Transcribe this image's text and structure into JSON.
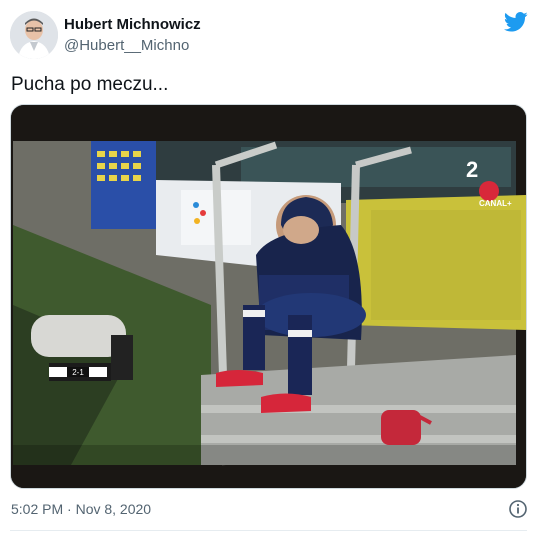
{
  "tweet": {
    "author_name": "Hubert Michnowicz",
    "author_handle": "@Hubert__Michno",
    "text": "Pucha po meczu...",
    "timestamp": "5:02 PM · Nov 8, 2020"
  },
  "media": {
    "channel_logo": "CANAL+",
    "channel_number": "2",
    "scoreboard": "2-1"
  },
  "icons": {
    "brand": "twitter-bird-icon",
    "info": "info-icon"
  },
  "colors": {
    "twitter_blue": "#1d9bf0",
    "text_primary": "#0f1419",
    "text_secondary": "#536471"
  }
}
